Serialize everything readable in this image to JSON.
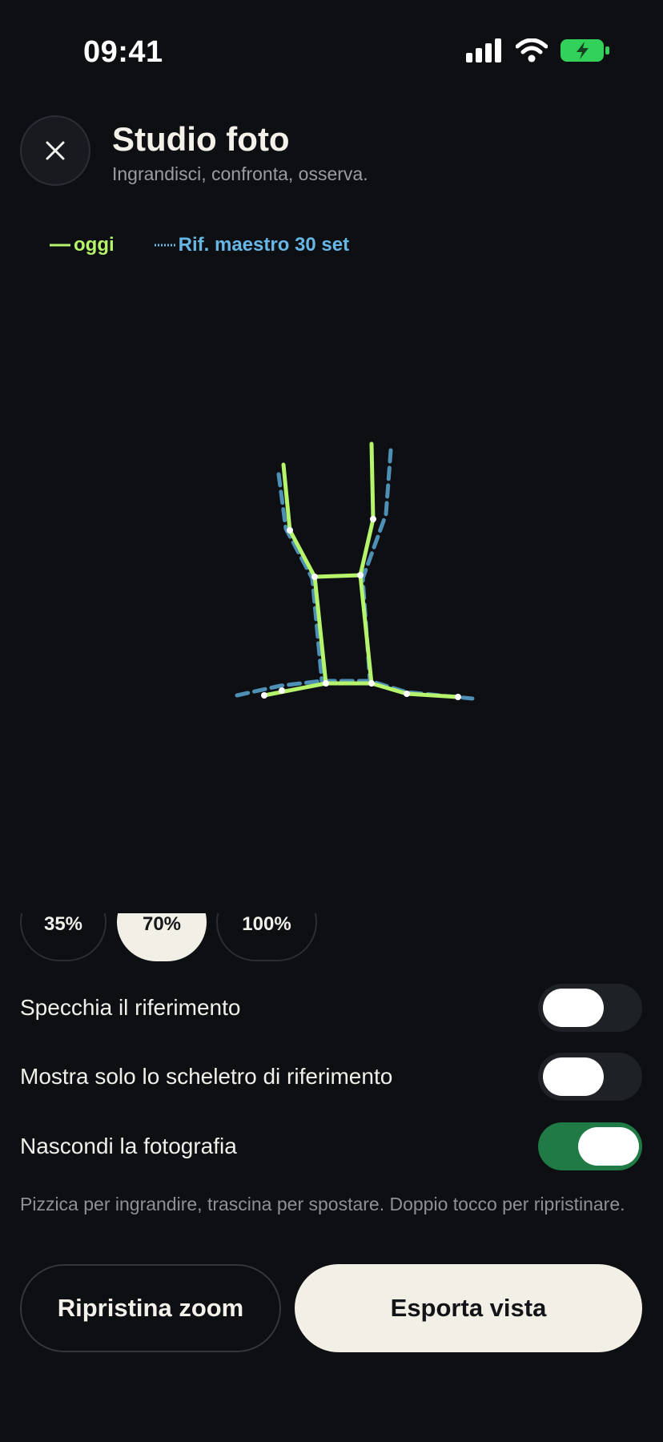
{
  "status_bar": {
    "time": "09:41"
  },
  "header": {
    "title": "Studio foto",
    "subtitle": "Ingrandisci, confronta, osserva."
  },
  "legend": {
    "today": "oggi",
    "reference": "Rif. maestro 30 set",
    "today_color": "#b6f56b",
    "reference_color": "#4e8fb6"
  },
  "opacity_options": [
    {
      "label": "35%",
      "selected": false
    },
    {
      "label": "70%",
      "selected": true
    },
    {
      "label": "100%",
      "selected": false
    }
  ],
  "settings": [
    {
      "label": "Specchia il riferimento",
      "enabled": false
    },
    {
      "label": "Mostra solo lo scheletro di riferimento",
      "enabled": false
    },
    {
      "label": "Nascondi la fotografia",
      "enabled": true
    }
  ],
  "hint": "Pizzica per ingrandire, trascina per spostare. Doppio tocco per ripristinare.",
  "buttons": {
    "reset_zoom": "Ripristina zoom",
    "export_view": "Esporta vista"
  },
  "icons": {
    "close": "close-icon",
    "signal": "signal-icon",
    "wifi": "wifi-icon",
    "battery": "battery-charging-icon"
  }
}
